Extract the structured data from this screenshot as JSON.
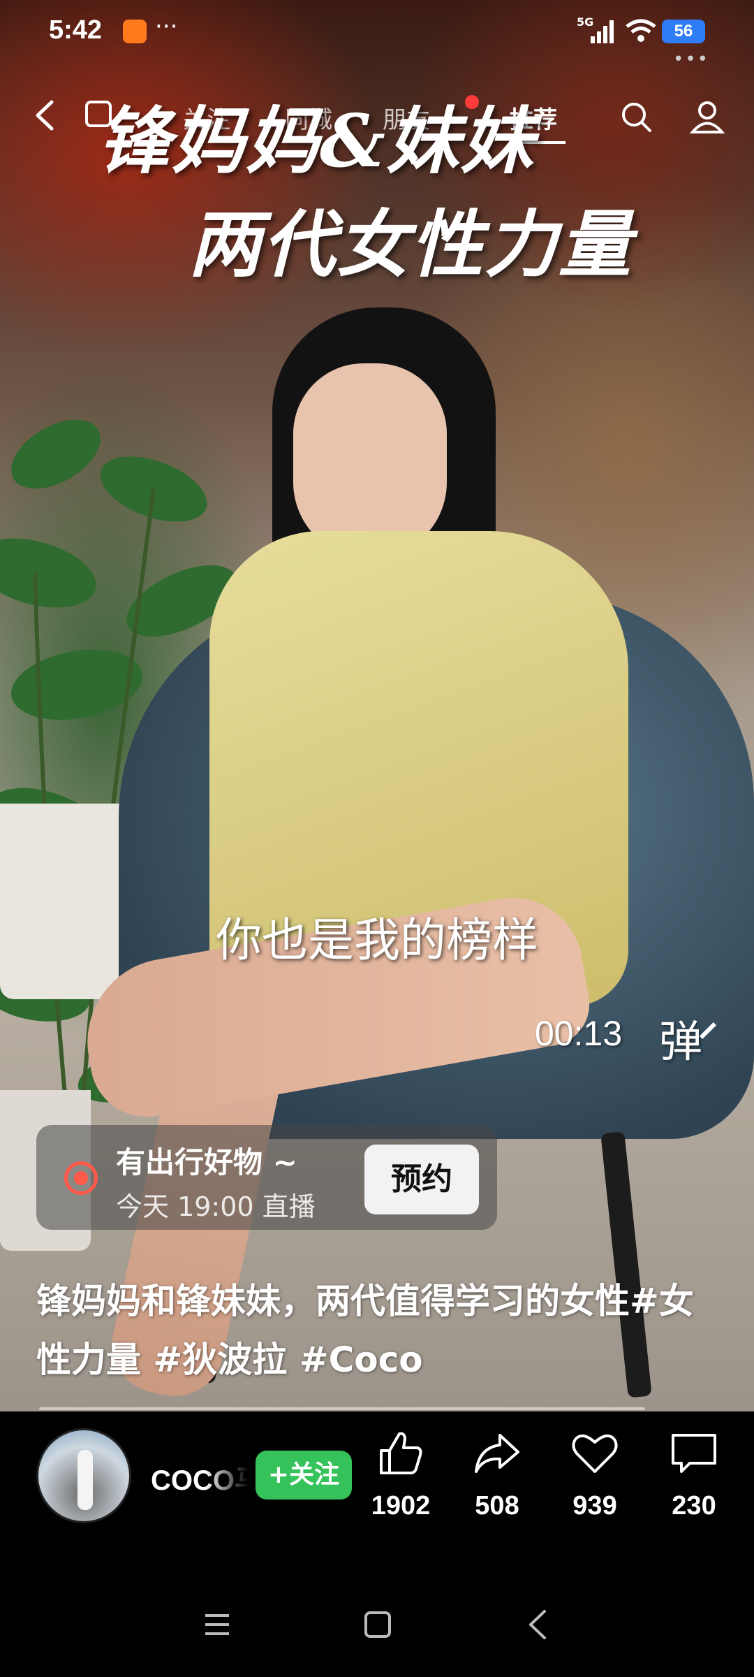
{
  "status_bar": {
    "time": "5:42",
    "more": "···",
    "network": "5G",
    "battery": "56",
    "overflow": "•••"
  },
  "nav": {
    "tabs": [
      {
        "label": "关注"
      },
      {
        "label": "同城"
      },
      {
        "label": "朋友"
      },
      {
        "label": "推荐"
      }
    ],
    "active_tab": "推荐",
    "accent_color": "#ff3b3b"
  },
  "video": {
    "title_line1": "锋妈妈&妹妹",
    "title_line2": "两代女性力量",
    "subtitle": "你也是我的榜样",
    "elapsed": "00:13",
    "danmaku_label": "弹"
  },
  "live_banner": {
    "title": "有出行好物 ~",
    "schedule": "今天 19:00 直播",
    "button_label": "预约"
  },
  "caption": "锋妈妈和锋妹妹，两代值得学习的女性#女性力量 #狄波拉 #Coco",
  "author": {
    "name": "COCO马",
    "follow_label": "+关注",
    "follow_color": "#35c25a"
  },
  "actions": [
    {
      "icon": "thumbs-up-icon",
      "count": "1902"
    },
    {
      "icon": "share-icon",
      "count": "508"
    },
    {
      "icon": "heart-icon",
      "count": "939"
    },
    {
      "icon": "comment-icon",
      "count": "230"
    }
  ],
  "system_nav": {
    "buttons": [
      "menu-icon",
      "home-icon",
      "back-icon"
    ]
  }
}
